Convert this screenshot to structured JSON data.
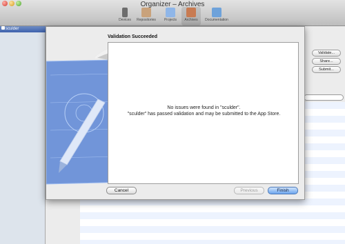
{
  "window": {
    "title": "Organizer – Archives"
  },
  "toolbar": {
    "items": [
      {
        "label": "Devices",
        "icon": "device-icon"
      },
      {
        "label": "Repositories",
        "icon": "repository-icon"
      },
      {
        "label": "Projects",
        "icon": "project-icon"
      },
      {
        "label": "Archives",
        "icon": "archive-icon"
      },
      {
        "label": "Documentation",
        "icon": "documentation-icon"
      }
    ]
  },
  "sidebar": {
    "selected_item": "sculder"
  },
  "side_buttons": {
    "validate": "Validate...",
    "share": "Share...",
    "submit": "Submit..."
  },
  "sheet": {
    "title": "Validation Succeeded",
    "message_line1": "No issues were found in \"sculder\".",
    "message_line2": "\"sculder\" has passed validation and may be submitted to the App Store.",
    "cancel_label": "Cancel",
    "previous_label": "Previous",
    "finish_label": "Finish"
  },
  "colors": {
    "accent": "#3e62ad",
    "finish_button": "#6ca6ee",
    "blueprint": "#5c86d6"
  }
}
